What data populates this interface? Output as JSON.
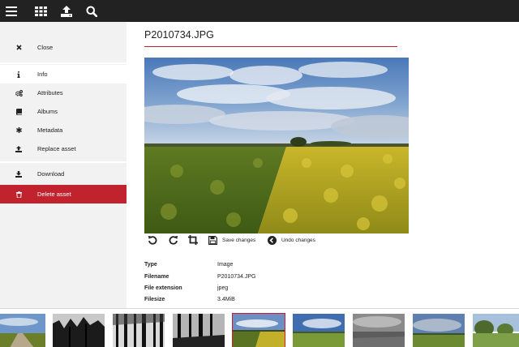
{
  "topbar": {
    "icons": [
      "menu-icon",
      "grid-icon",
      "upload-icon",
      "search-icon"
    ]
  },
  "sidebar": {
    "items": [
      {
        "label": "Close",
        "icon": "close-icon"
      },
      {
        "label": "Info",
        "icon": "info-icon"
      },
      {
        "label": "Attributes",
        "icon": "cogs-icon"
      },
      {
        "label": "Albums",
        "icon": "book-icon"
      },
      {
        "label": "Metadata",
        "icon": "asterisk-icon"
      },
      {
        "label": "Replace asset",
        "icon": "upload-icon"
      },
      {
        "label": "Download",
        "icon": "download-icon"
      },
      {
        "label": "Delete asset",
        "icon": "trash-icon"
      }
    ],
    "active_item": "Info",
    "colors": {
      "danger": "#c0222e"
    }
  },
  "main": {
    "title": "P2010734.JPG",
    "toolbar": {
      "save_label": "Save changes",
      "undo_label": "Undo changes"
    },
    "meta": [
      {
        "key": "Type",
        "value": "Image"
      },
      {
        "key": "Filename",
        "value": "P2010734.JPG"
      },
      {
        "key": "File extension",
        "value": "jpeg"
      },
      {
        "key": "Filesize",
        "value": "3.4MiB"
      }
    ]
  },
  "filmstrip": {
    "thumbnails": [
      {
        "kind": "field-path"
      },
      {
        "kind": "bw-trees"
      },
      {
        "kind": "bw-forest"
      },
      {
        "kind": "bw-trees-dark"
      },
      {
        "kind": "rapeseed-field",
        "selected": true
      },
      {
        "kind": "green-field"
      },
      {
        "kind": "grey-field"
      },
      {
        "kind": "cloudy-field"
      },
      {
        "kind": "trees-field"
      }
    ]
  }
}
